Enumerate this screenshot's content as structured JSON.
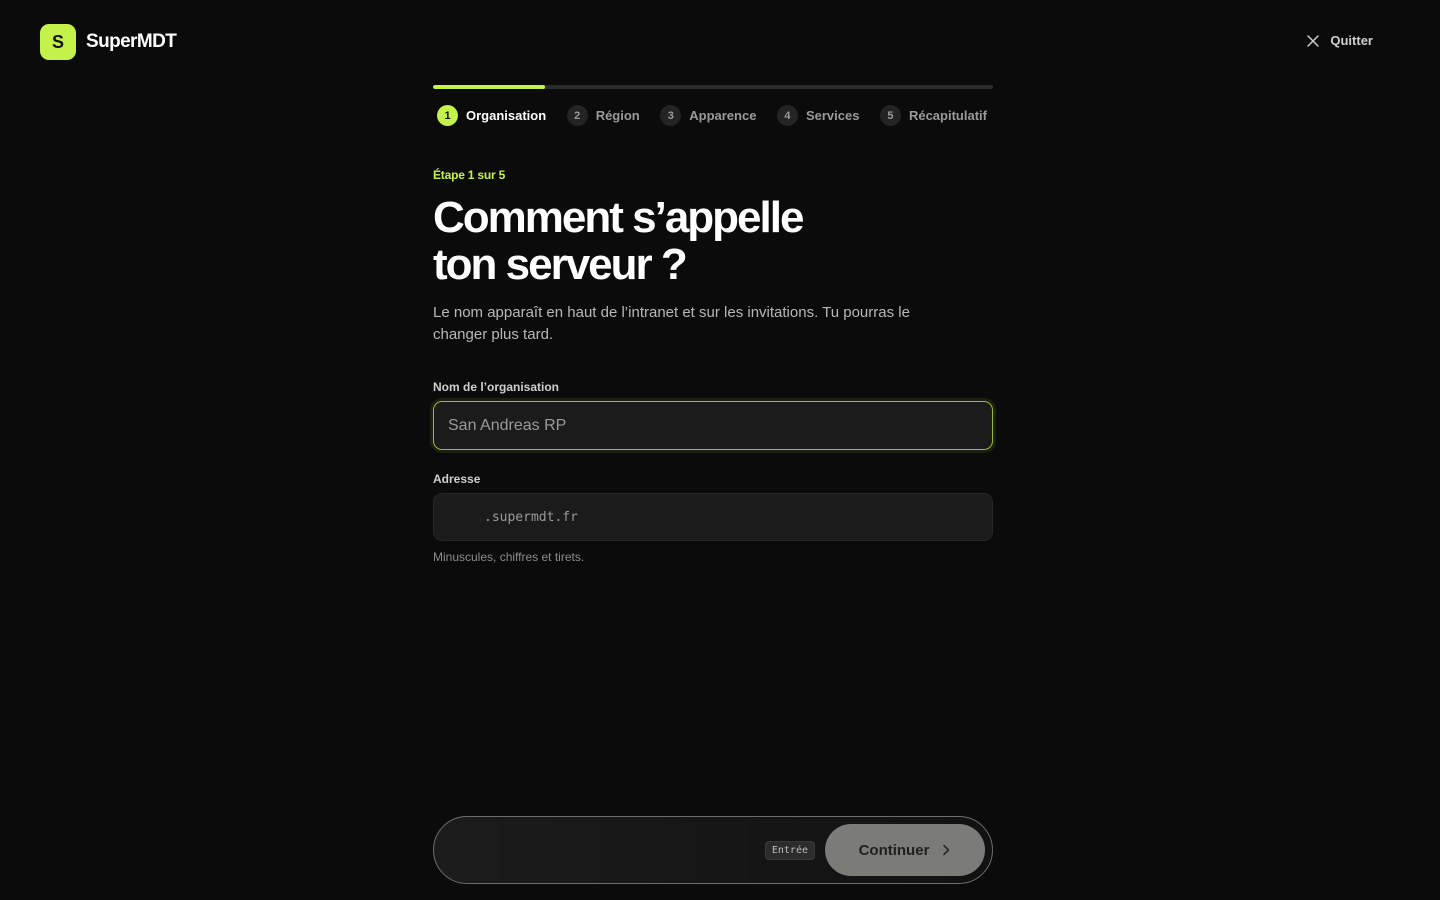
{
  "brand": {
    "logo_letter": "S",
    "name": "SuperMDT",
    "accent_color": "#c4f24a"
  },
  "header": {
    "quit_label": "Quitter",
    "quit_icon": "close-icon"
  },
  "stepper": {
    "progress": 0.2,
    "steps": [
      {
        "number": "1",
        "label": "Organisation",
        "state": "active"
      },
      {
        "number": "2",
        "label": "Région",
        "state": "upcoming"
      },
      {
        "number": "3",
        "label": "Apparence",
        "state": "upcoming"
      },
      {
        "number": "4",
        "label": "Services",
        "state": "upcoming"
      },
      {
        "number": "5",
        "label": "Récapitulatif",
        "state": "upcoming"
      }
    ]
  },
  "main": {
    "eyebrow": "Étape 1 sur 5",
    "title_line1": "Comment s’appelle",
    "title_line2": "ton serveur ?",
    "description": "Le nom apparaît en haut de l’intranet et sur les invitations. Tu pourras le changer plus tard.",
    "org_field": {
      "label": "Nom de l’organisation",
      "placeholder": "San Andreas RP",
      "value": ""
    },
    "address_field": {
      "label": "Adresse",
      "value": "",
      "suffix": ".supermdt.fr",
      "hint": "Minuscules, chiffres et tirets."
    }
  },
  "footer": {
    "key_hint": "Entrée",
    "continue_label": "Continuer",
    "continue_icon": "chevron-right-icon"
  }
}
